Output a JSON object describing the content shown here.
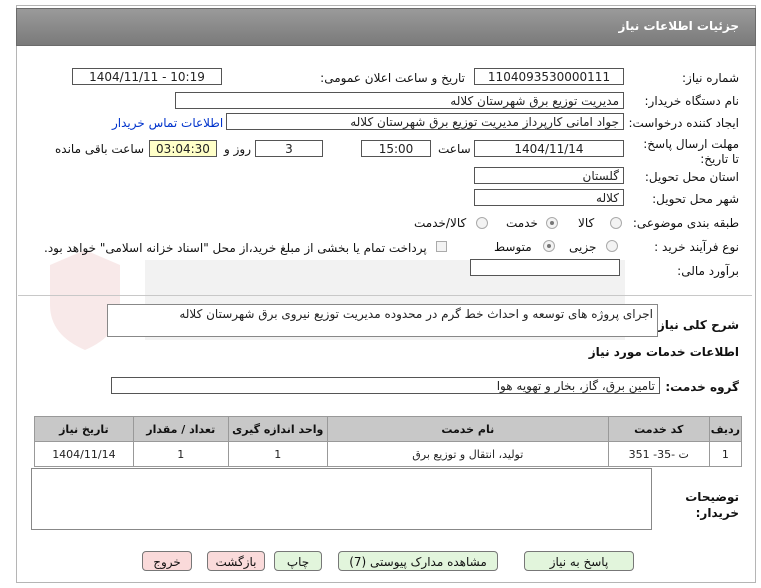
{
  "header": {
    "title": "جزئیات اطلاعات نیاز"
  },
  "labels": {
    "need_number": "شماره نیاز:",
    "announce_datetime": "تاریخ و ساعت اعلان عمومی:",
    "buyer_org": "نام دستگاه خریدار:",
    "creator": "ایجاد کننده درخواست:",
    "deadline": "مهلت ارسال پاسخ: تا تاریخ:",
    "time_word": "ساعت",
    "days_and": "روز و",
    "remaining": "ساعت باقی مانده",
    "province": "استان محل تحویل:",
    "city": "شهر محل تحویل:",
    "category": "طبقه بندی موضوعی:",
    "process_type": "نوع فرآیند خرید :",
    "estimate": "برآورد مالی:",
    "general_desc": "شرح کلی نیاز:",
    "services_info": "اطلاعات خدمات مورد نیاز",
    "service_group": "گروه خدمت:",
    "buyer_notes": "توضیحات خریدار:"
  },
  "values": {
    "need_number": "1104093530000111",
    "announce_datetime": "1404/11/11 - 10:19",
    "buyer_org": "مدیریت توزیع برق شهرستان کلاله",
    "creator": "جواد امانی کارپرداز مدیریت توزیع برق شهرستان کلاله",
    "contact_link": "اطلاعات تماس خریدار",
    "deadline_date": "1404/11/14",
    "deadline_time": "15:00",
    "days": "3",
    "remaining_time": "03:04:30",
    "province": "گلستان",
    "city": "کلاله",
    "estimate": "",
    "general_desc": "اجرای پروژه های توسعه و احداث خط گرم در محدوده مدیریت توزیع نیروی برق شهرستان کلاله",
    "service_group": "تامین برق، گاز، بخار و تهویه هوا",
    "buyer_notes": ""
  },
  "category_options": [
    {
      "label": "کالا",
      "selected": false
    },
    {
      "label": "خدمت",
      "selected": true
    },
    {
      "label": "کالا/خدمت",
      "selected": false
    }
  ],
  "process_options": [
    {
      "label": "جزیی",
      "selected": false
    },
    {
      "label": "متوسط",
      "selected": true
    }
  ],
  "payment_note": "پرداخت تمام یا بخشی از مبلغ خرید،از محل \"اسناد خزانه اسلامی\" خواهد بود.",
  "table": {
    "headers": [
      "ردیف",
      "کد خدمت",
      "نام خدمت",
      "واحد اندازه گیری",
      "تعداد / مقدار",
      "تاریخ نیاز"
    ],
    "rows": [
      [
        "1",
        "ت -35- 351",
        "تولید، انتقال و توزیع برق",
        "1",
        "1",
        "1404/11/14"
      ]
    ]
  },
  "buttons": {
    "reply": "پاسخ به نیاز",
    "attachments": "مشاهده مدارک پیوستی (7)",
    "print": "چاپ",
    "back": "بازگشت",
    "exit": "خروج"
  },
  "colors": {
    "header_bg": "#8a8a8a",
    "link": "#0033cc",
    "time_box": "#ffffc8",
    "green_button": "#e2f5dc",
    "pink_button": "#fadada"
  }
}
